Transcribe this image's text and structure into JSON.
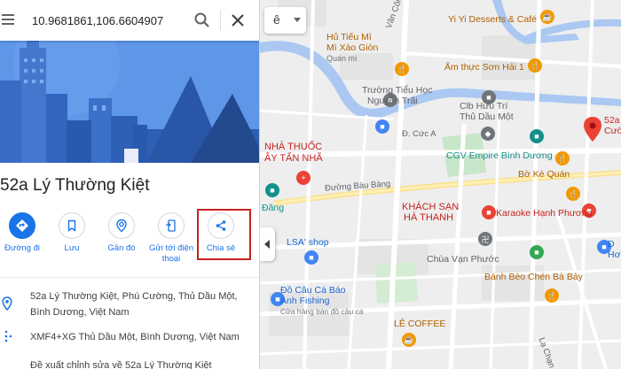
{
  "search": {
    "value": "10.9681861,106.6604907"
  },
  "place": {
    "title": "52a Lý Thường Kiệt",
    "actions": [
      {
        "label": "Đường đi"
      },
      {
        "label": "Lưu"
      },
      {
        "label": "Gần đó"
      },
      {
        "label_line1": "Gửi tới điện",
        "label_line2": "thoại"
      },
      {
        "label": "Chia sẻ"
      }
    ],
    "address_line1": "52a Lý Thường Kiệt, Phú Cường, Thủ Dầu Một,",
    "address_line2": "Bình Dương, Việt Nam",
    "plus_code": "XMF4+XG Thủ Dầu Một, Bình Dương, Việt Nam",
    "suggest_edit": "Đề xuất chỉnh sửa về 52a Lý Thường Kiệt"
  },
  "map": {
    "lang_button": "ê",
    "labels": {
      "yiyi": "Yi Yi Desserts & Café",
      "hutieu1": "Hủ Tiếu Mì",
      "hutieu2": "Mì Xào Giòn",
      "hutieu3": "Quán mì",
      "vanconggao": "Văn Công Khai",
      "amthuc": "Ẩm thực Sơn Hải 1",
      "truong1": "Trường Tiểu Học",
      "truong2": "Nguyễn Trãi",
      "clb1": "Clb Hưu Trí",
      "clb2": "Thủ Dầu Một",
      "place_r1": "52a",
      "place_r2": "Cườ",
      "nhathuoc1": "NHÀ THUỐC",
      "nhathuoc2": "ÂY TẤN NHÃ",
      "cuca": "Đ. Cức A",
      "cgv": "CGV Empire Bình Dương",
      "boke": "Bờ Kè Quán",
      "duongbaubang": "Đường Bàu Bàng",
      "dang": "Đăng",
      "khachsan1": "KHÁCH SẠN",
      "khachsan2": "HÀ THANH",
      "karaoke": "Karaoke Hạnh Phương",
      "lsa": "LSA' shop",
      "chua": "Chùa Vạn Phước",
      "docau1": "Đồ Câu Cá Báo",
      "docau2": "Anh Fishing",
      "docau3": "Cửa hàng bán đồ câu cá",
      "banhbeo": "Bánh Bèo Chén Bà Bảy",
      "leecoffee": "LÊ COFFEE",
      "ho1": "Đ",
      "ho2": "Hơi Ba",
      "lachan": "Lạ Chạn"
    }
  }
}
